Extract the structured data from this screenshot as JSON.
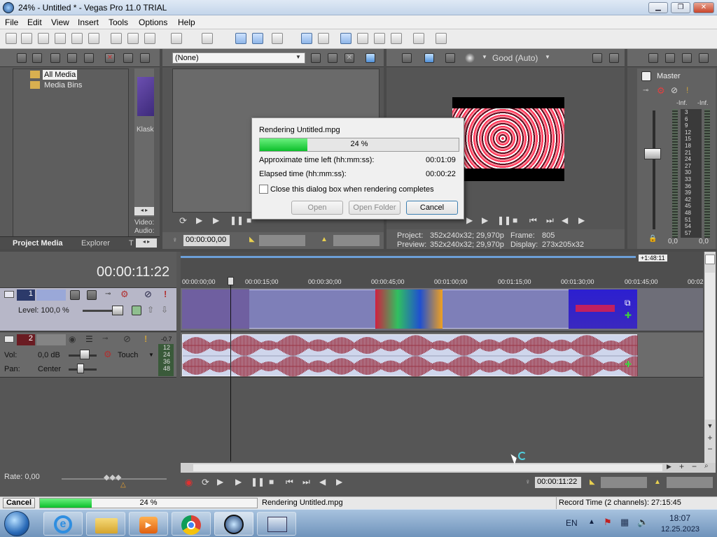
{
  "window": {
    "title": "24% - Untitled * - Vegas Pro 11.0 TRIAL"
  },
  "menu": [
    "File",
    "Edit",
    "View",
    "Insert",
    "Tools",
    "Options",
    "Help"
  ],
  "media": {
    "tree": [
      "All Media",
      "Media Bins"
    ],
    "thumb_label": "Klask",
    "video_label": "Video:",
    "audio_label": "Audio:",
    "tabs": [
      "Project Media",
      "Explorer",
      "T"
    ]
  },
  "trimmer": {
    "dropdown": "(None)",
    "timecode": "00:00:00,00"
  },
  "preview": {
    "quality": "Good (Auto)",
    "project_label": "Project:",
    "project_value": "352x240x32; 29,970p",
    "frame_label": "Frame:",
    "frame_value": "805",
    "preview_label": "Preview:",
    "preview_value": "352x240x32; 29,970p",
    "display_label": "Display:",
    "display_value": "273x205x32"
  },
  "master": {
    "label": "Master",
    "inf_left": "-Inf.",
    "inf_right": "-Inf.",
    "scale": [
      "3",
      "6",
      "9",
      "12",
      "15",
      "18",
      "21",
      "24",
      "27",
      "30",
      "33",
      "36",
      "39",
      "42",
      "45",
      "48",
      "51",
      "54",
      "57"
    ],
    "bottom_left": "0,0",
    "bottom_right": "0,0"
  },
  "dialog": {
    "title": "Rendering Untitled.mpg",
    "progress_text": "24 %",
    "progress": 0.24,
    "time_left_label": "Approximate time left (hh:mm:ss):",
    "time_left_value": "00:01:09",
    "elapsed_label": "Elapsed time (hh:mm:ss):",
    "elapsed_value": "00:00:22",
    "checkbox_label": "Close this dialog box when rendering completes",
    "buttons": {
      "open": "Open",
      "open_folder": "Open Folder",
      "cancel": "Cancel"
    }
  },
  "timeline": {
    "cursor_time": "00:00:11:22",
    "region_label": "+1:48:11",
    "ruler": [
      "00:00:00;00",
      "00:00:15;00",
      "00:00:30;00",
      "00:00:45;00",
      "00:01:00;00",
      "00:01:15;00",
      "00:01:30;00",
      "00:01:45;00",
      "00:02"
    ],
    "video_track": {
      "number": "1",
      "level_label": "Level: 100,0 %"
    },
    "audio_track": {
      "number": "2",
      "vol_label": "Vol:",
      "vol_value": "0,0 dB",
      "pan_label": "Pan:",
      "pan_value": "Center",
      "automation": "Touch",
      "meter_scale": [
        "12",
        "24",
        "36",
        "48"
      ],
      "meter_top": "-0.7"
    },
    "rate_label": "Rate: 0,00",
    "bottom_timecode": "00:00:11:22"
  },
  "statusbar": {
    "cancel": "Cancel",
    "progress_text": "24 %",
    "progress": 0.24,
    "message": "Rendering Untitled.mpg",
    "record_time": "Record Time (2 channels): 27:15:45"
  },
  "taskbar": {
    "lang": "EN",
    "time": "18:07",
    "date": "12.25.2023"
  },
  "colors": {
    "video_track_bg": "#7e7fb8",
    "audio_wave": "#9a3344",
    "progress_green": "#1ccb3a"
  }
}
